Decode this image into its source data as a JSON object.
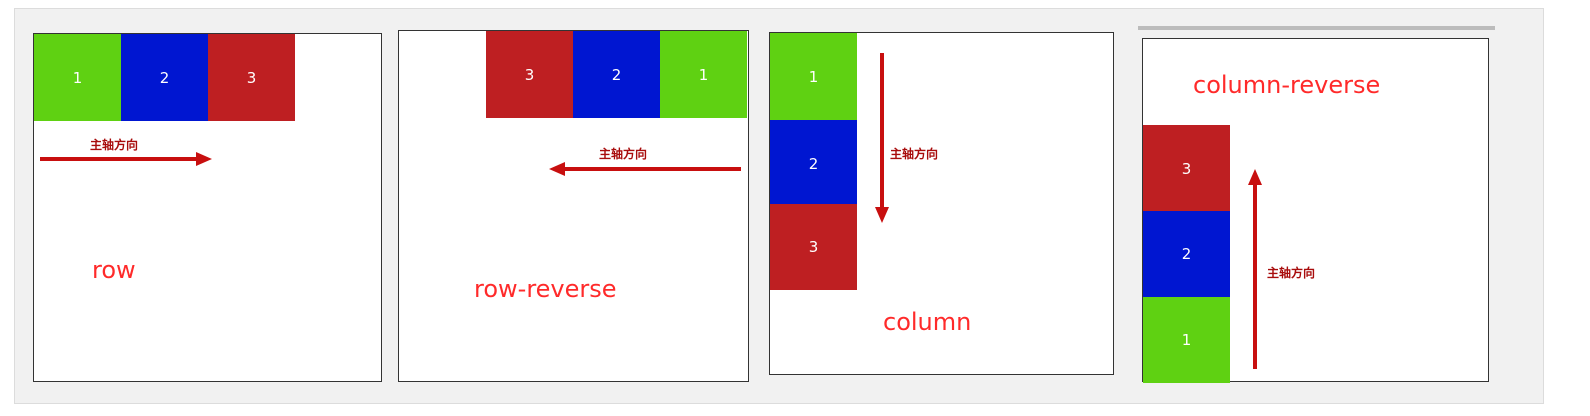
{
  "axis_label": "主轴方向",
  "colors": {
    "green": "#5fd112",
    "blue": "#0016d1",
    "red": "#be1f22",
    "label": "#ff2a2a"
  },
  "panels": [
    {
      "mode": "row",
      "items": [
        "1",
        "2",
        "3"
      ],
      "arrow": "right"
    },
    {
      "mode": "row-reverse",
      "items": [
        "3",
        "2",
        "1"
      ],
      "arrow": "left"
    },
    {
      "mode": "column",
      "items": [
        "1",
        "2",
        "3"
      ],
      "arrow": "down"
    },
    {
      "mode": "column-reverse",
      "items": [
        "3",
        "2",
        "1"
      ],
      "arrow": "up"
    }
  ]
}
